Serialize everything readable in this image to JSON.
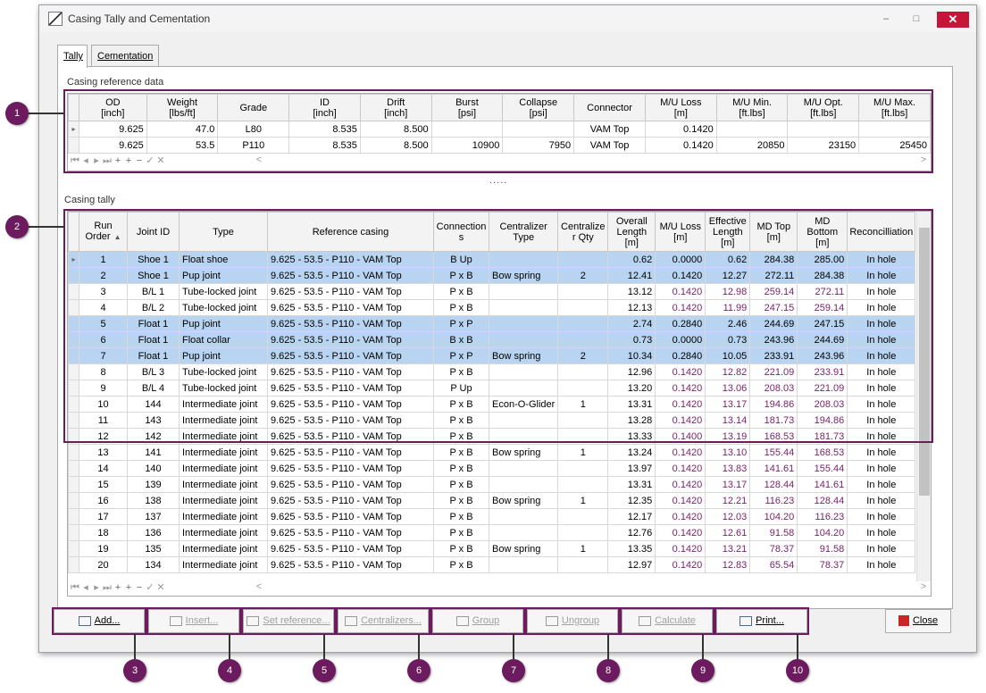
{
  "window": {
    "title": "Casing Tally and Cementation",
    "minimize": "–",
    "maximize": "□",
    "close": "✕"
  },
  "tabs": [
    {
      "label": "Tally"
    },
    {
      "label": "Cementation"
    }
  ],
  "reference": {
    "label": "Casing reference data",
    "columns": [
      "OD\n[inch]",
      "Weight\n[lbs/ft]",
      "Grade",
      "ID\n[inch]",
      "Drift\n[inch]",
      "Burst\n[psi]",
      "Collapse\n[psi]",
      "Connector",
      "M/U Loss\n[m]",
      "M/U Min.\n[ft.lbs]",
      "M/U Opt.\n[ft.lbs]",
      "M/U Max.\n[ft.lbs]"
    ],
    "rows": [
      [
        "9.625",
        "47.0",
        "L80",
        "8.535",
        "8.500",
        "",
        "",
        "VAM Top",
        "0.1420",
        "",
        "",
        ""
      ],
      [
        "9.625",
        "53.5",
        "P110",
        "8.535",
        "8.500",
        "10900",
        "7950",
        "VAM Top",
        "0.1420",
        "20850",
        "23150",
        "25450"
      ]
    ]
  },
  "splitter": ".....",
  "tally": {
    "label": "Casing tally",
    "columns": [
      "Run\nOrder",
      "Joint ID",
      "Type",
      "Reference casing",
      "Connection\ns",
      "Centralizer\nType",
      "Centralize\nr Qty",
      "Overall\nLength\n[m]",
      "M/U Loss\n[m]",
      "Effective\nLength\n[m]",
      "MD Top\n[m]",
      "MD\nBottom\n[m]",
      "Reconcilliation"
    ],
    "sort_arrow": "▲",
    "rows": [
      [
        "1",
        "Shoe 1",
        "Float shoe",
        "9.625 - 53.5 - P110 - VAM Top",
        "B Up",
        "",
        "",
        "0.62",
        "0.0000",
        "0.62",
        "284.38",
        "285.00",
        "In hole"
      ],
      [
        "2",
        "Shoe 1",
        "Pup joint",
        "9.625 - 53.5 - P110 - VAM Top",
        "P x B",
        "Bow spring",
        "2",
        "12.41",
        "0.1420",
        "12.27",
        "272.11",
        "284.38",
        "In hole"
      ],
      [
        "3",
        "B/L 1",
        "Tube-locked joint",
        "9.625 - 53.5 - P110 - VAM Top",
        "P x B",
        "",
        "",
        "13.12",
        "0.1420",
        "12.98",
        "259.14",
        "272.11",
        "In hole"
      ],
      [
        "4",
        "B/L 2",
        "Tube-locked joint",
        "9.625 - 53.5 - P110 - VAM Top",
        "P x B",
        "",
        "",
        "12.13",
        "0.1420",
        "11.99",
        "247.15",
        "259.14",
        "In hole"
      ],
      [
        "5",
        "Float 1",
        "Pup joint",
        "9.625 - 53.5 - P110 - VAM Top",
        "P x P",
        "",
        "",
        "2.74",
        "0.2840",
        "2.46",
        "244.69",
        "247.15",
        "In hole"
      ],
      [
        "6",
        "Float 1",
        "Float collar",
        "9.625 - 53.5 - P110 - VAM Top",
        "B x B",
        "",
        "",
        "0.73",
        "0.0000",
        "0.73",
        "243.96",
        "244.69",
        "In hole"
      ],
      [
        "7",
        "Float 1",
        "Pup joint",
        "9.625 - 53.5 - P110 - VAM Top",
        "P x P",
        "Bow spring",
        "2",
        "10.34",
        "0.2840",
        "10.05",
        "233.91",
        "243.96",
        "In hole"
      ],
      [
        "8",
        "B/L 3",
        "Tube-locked joint",
        "9.625 - 53.5 - P110 - VAM Top",
        "P x B",
        "",
        "",
        "12.96",
        "0.1420",
        "12.82",
        "221.09",
        "233.91",
        "In hole"
      ],
      [
        "9",
        "B/L 4",
        "Tube-locked joint",
        "9.625 - 53.5 - P110 - VAM Top",
        "P Up",
        "",
        "",
        "13.20",
        "0.1420",
        "13.06",
        "208.03",
        "221.09",
        "In hole"
      ],
      [
        "10",
        "144",
        "Intermediate joint",
        "9.625 - 53.5 - P110 - VAM Top",
        "P x B",
        "Econ-O-Glider",
        "1",
        "13.31",
        "0.1420",
        "13.17",
        "194.86",
        "208.03",
        "In hole"
      ],
      [
        "11",
        "143",
        "Intermediate joint",
        "9.625 - 53.5 - P110 - VAM Top",
        "P x B",
        "",
        "",
        "13.28",
        "0.1420",
        "13.14",
        "181.73",
        "194.86",
        "In hole"
      ],
      [
        "12",
        "142",
        "Intermediate joint",
        "9.625 - 53.5 - P110 - VAM Top",
        "P x B",
        "",
        "",
        "13.33",
        "0.1400",
        "13.19",
        "168.53",
        "181.73",
        "In hole"
      ],
      [
        "13",
        "141",
        "Intermediate joint",
        "9.625 - 53.5 - P110 - VAM Top",
        "P x B",
        "Bow spring",
        "1",
        "13.24",
        "0.1420",
        "13.10",
        "155.44",
        "168.53",
        "In hole"
      ],
      [
        "14",
        "140",
        "Intermediate joint",
        "9.625 - 53.5 - P110 - VAM Top",
        "P x B",
        "",
        "",
        "13.97",
        "0.1420",
        "13.83",
        "141.61",
        "155.44",
        "In hole"
      ],
      [
        "15",
        "139",
        "Intermediate joint",
        "9.625 - 53.5 - P110 - VAM Top",
        "P x B",
        "",
        "",
        "13.31",
        "0.1420",
        "13.17",
        "128.44",
        "141.61",
        "In hole"
      ],
      [
        "16",
        "138",
        "Intermediate joint",
        "9.625 - 53.5 - P110 - VAM Top",
        "P x B",
        "Bow spring",
        "1",
        "12.35",
        "0.1420",
        "12.21",
        "116.23",
        "128.44",
        "In hole"
      ],
      [
        "17",
        "137",
        "Intermediate joint",
        "9.625 - 53.5 - P110 - VAM Top",
        "P x B",
        "",
        "",
        "12.17",
        "0.1420",
        "12.03",
        "104.20",
        "116.23",
        "In hole"
      ],
      [
        "18",
        "136",
        "Intermediate joint",
        "9.625 - 53.5 - P110 - VAM Top",
        "P x B",
        "",
        "",
        "12.76",
        "0.1420",
        "12.61",
        "91.58",
        "104.20",
        "In hole"
      ],
      [
        "19",
        "135",
        "Intermediate joint",
        "9.625 - 53.5 - P110 - VAM Top",
        "P x B",
        "Bow spring",
        "1",
        "13.35",
        "0.1420",
        "13.21",
        "78.37",
        "91.58",
        "In hole"
      ],
      [
        "20",
        "134",
        "Intermediate joint",
        "9.625 - 53.5 - P110 - VAM Top",
        "P x B",
        "",
        "",
        "12.97",
        "0.1420",
        "12.83",
        "65.54",
        "78.37",
        "In hole"
      ]
    ],
    "highlighted_rows": [
      1,
      2,
      5,
      6,
      7
    ]
  },
  "navigator": {
    "first": "⏮",
    "prev": "◂",
    "next": "▸",
    "last": "⏭",
    "add": "+",
    "insert": "+",
    "delete": "−",
    "ok": "✓",
    "cancel": "✕",
    "hscroll_left": "<",
    "hscroll_right": ">"
  },
  "buttons": [
    {
      "label": "Add...",
      "enabled": true,
      "badge": "3"
    },
    {
      "label": "Insert...",
      "enabled": false,
      "badge": "4"
    },
    {
      "label": "Set reference...",
      "enabled": false,
      "badge": "5"
    },
    {
      "label": "Centralizers...",
      "enabled": false,
      "badge": "6"
    },
    {
      "label": "Group",
      "enabled": false,
      "badge": "7"
    },
    {
      "label": "Ungroup",
      "enabled": false,
      "badge": "8"
    },
    {
      "label": "Calculate",
      "enabled": false,
      "badge": "9"
    },
    {
      "label": "Print...",
      "enabled": true,
      "badge": "10"
    }
  ],
  "close_button": {
    "label": "Close"
  },
  "callouts": {
    "ref": "1",
    "tally": "2"
  },
  "colors": {
    "accent": "#6b1b5e",
    "selection": "#b8d4f0",
    "computed_text": "#7a1f6a",
    "close": "#c7153a"
  }
}
